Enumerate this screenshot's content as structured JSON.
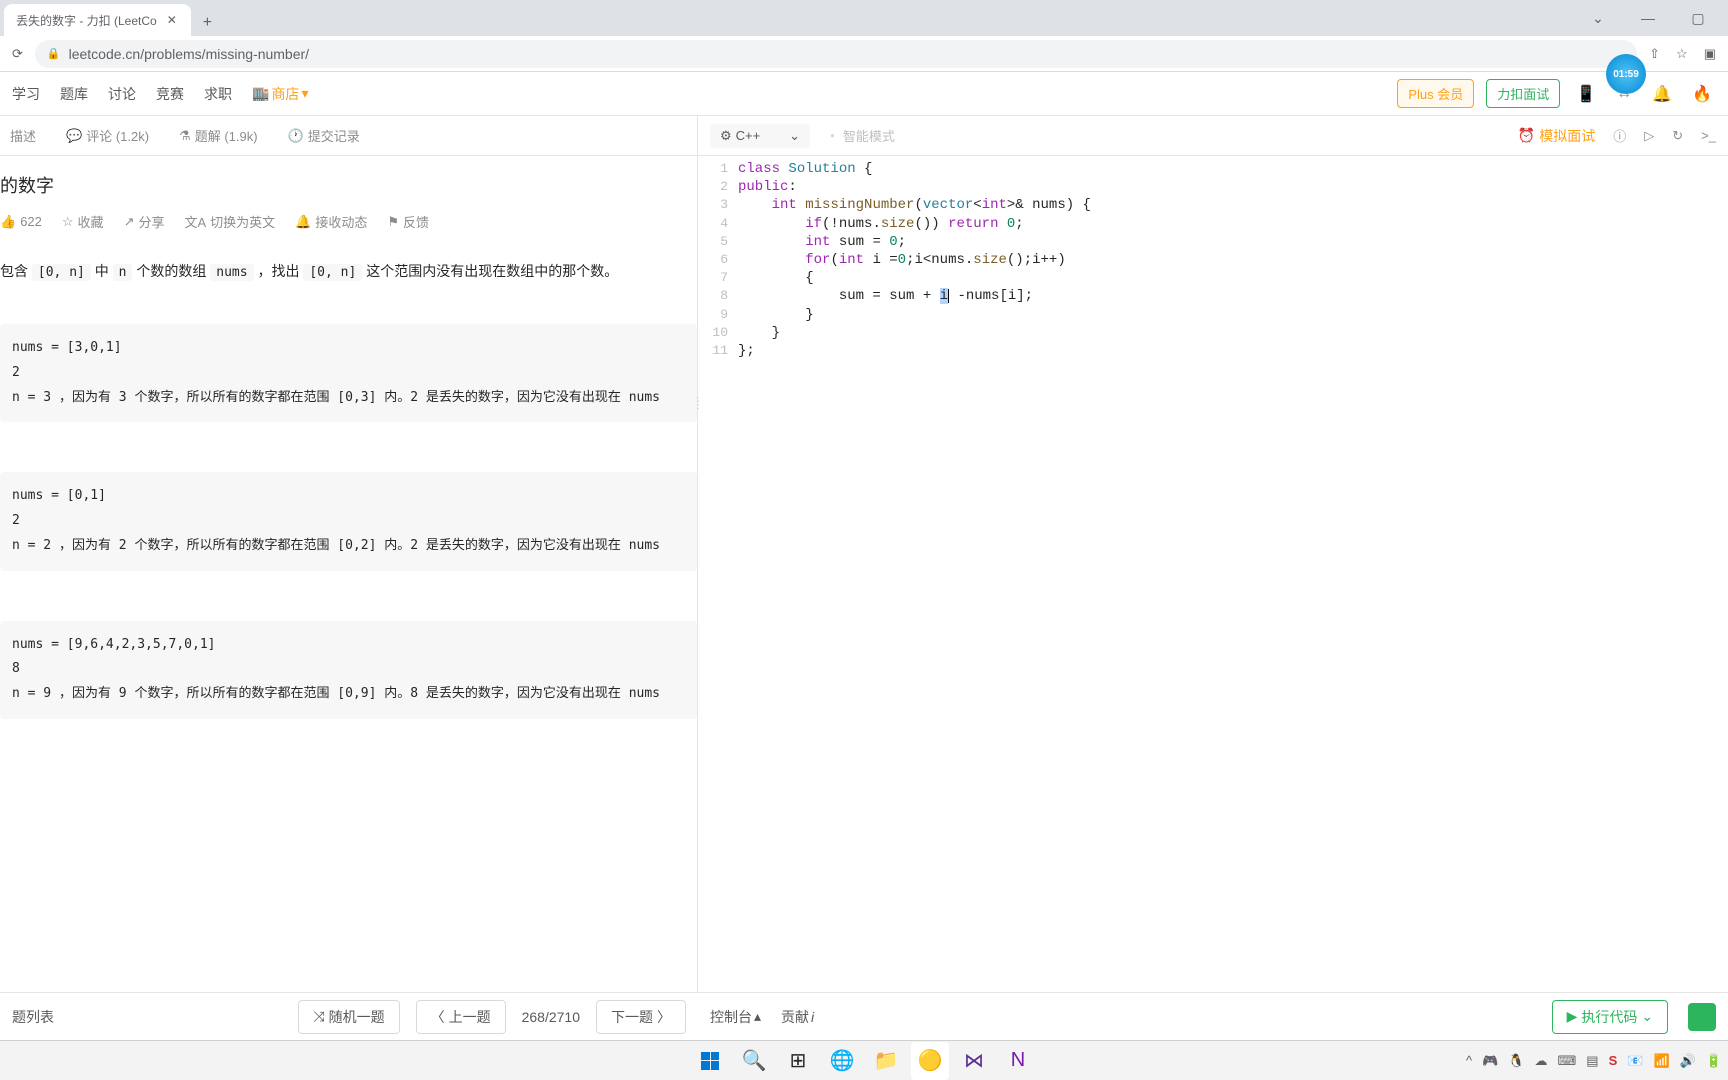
{
  "browser": {
    "tab_title": "丢失的数字 - 力扣 (LeetCo",
    "url": "leetcode.cn/problems/missing-number/"
  },
  "nav": {
    "study": "学习",
    "problems": "题库",
    "discuss": "讨论",
    "contest": "竞赛",
    "jobs": "求职",
    "store": "商店",
    "plus": "Plus 会员",
    "interview": "力扣面试"
  },
  "timer": "01:59",
  "tabs": {
    "desc": "描述",
    "comments": "评论 (1.2k)",
    "solutions": "题解 (1.9k)",
    "submissions": "提交记录"
  },
  "problem": {
    "title": "的数字",
    "like_count": "622",
    "collect": "收藏",
    "share": "分享",
    "translate": "切换为英文",
    "notify": "接收动态",
    "feedback": "反馈",
    "desc_pre": "包含 ",
    "desc_range1": "[0, n]",
    "desc_mid1": " 中 ",
    "desc_n": "n",
    "desc_mid2": " 个数的数组 ",
    "desc_nums": "nums",
    "desc_mid3": " ，找出 ",
    "desc_range2": "[0, n]",
    "desc_end": " 这个范围内没有出现在数组中的那个数。"
  },
  "examples": {
    "ex1_l1": "nums = [3,0,1]",
    "ex1_l2": "2",
    "ex1_l3": "n = 3 ，因为有 3 个数字，所以所有的数字都在范围 [0,3] 内。2 是丢失的数字，因为它没有出现在 nums",
    "ex2_l1": "nums = [0,1]",
    "ex2_l2": "2",
    "ex2_l3": "n = 2 ，因为有 2 个数字，所以所有的数字都在范围 [0,2] 内。2 是丢失的数字，因为它没有出现在 nums",
    "ex3_l1": "nums = [9,6,4,2,3,5,7,0,1]",
    "ex3_l2": "8",
    "ex3_l3": "n = 9 ，因为有 9 个数字，所以所有的数字都在范围 [0,9] 内。8 是丢失的数字，因为它没有出现在 nums"
  },
  "editor": {
    "lang": "C++",
    "smart": "智能模式",
    "mock": "模拟面试"
  },
  "code_lines": [
    "1",
    "2",
    "3",
    "4",
    "5",
    "6",
    "7",
    "8",
    "9",
    "10",
    "11"
  ],
  "footer": {
    "list": "题列表",
    "random": "随机一题",
    "prev": "上一题",
    "position": "268/2710",
    "next": "下一题",
    "console": "控制台",
    "contribute": "贡献",
    "run": "执行代码"
  }
}
